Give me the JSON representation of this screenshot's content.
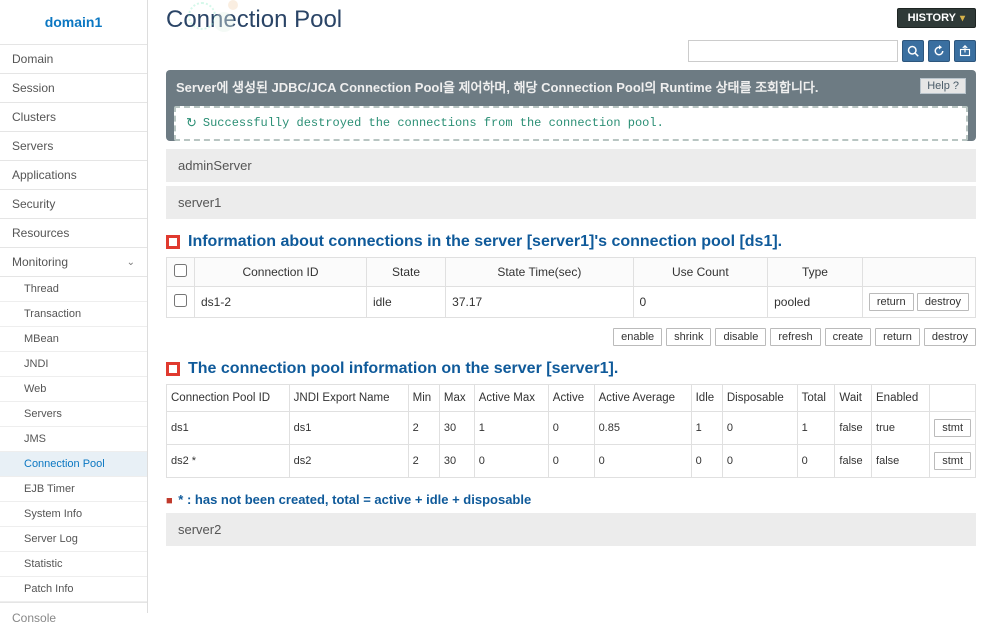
{
  "brand": "domain1",
  "nav": {
    "items": [
      "Domain",
      "Session",
      "Clusters",
      "Servers",
      "Applications",
      "Security",
      "Resources",
      "Monitoring"
    ],
    "expanded_label": "Monitoring",
    "sub": [
      "Thread",
      "Transaction",
      "MBean",
      "JNDI",
      "Web",
      "Servers",
      "JMS",
      "Connection Pool",
      "EJB Timer",
      "System Info",
      "Server Log",
      "Statistic",
      "Patch Info"
    ],
    "active_sub": "Connection Pool",
    "console": "Console"
  },
  "buttons": {
    "history": "HISTORY",
    "help": "Help ?",
    "enable": "enable",
    "shrink": "shrink",
    "disable": "disable",
    "refresh": "refresh",
    "create": "create",
    "return": "return",
    "destroy": "destroy",
    "stmt": "stmt"
  },
  "page": {
    "title": "Connection Pool"
  },
  "notice": {
    "text": "Server에 생성된 JDBC/JCA Connection Pool을 제어하며, 해당 Connection Pool의 Runtime 상태를 조회합니다.",
    "success": "Successfully destroyed the connections from the connection pool."
  },
  "servers": {
    "admin": "adminServer",
    "s1": "server1",
    "s2": "server2"
  },
  "section1": {
    "title": "Information about connections in the server [server1]'s connection pool [ds1].",
    "headers": [
      "Connection ID",
      "State",
      "State Time(sec)",
      "Use Count",
      "Type"
    ],
    "rows": [
      {
        "id": "ds1-2",
        "state": "idle",
        "time": "37.17",
        "use": "0",
        "type": "pooled"
      }
    ]
  },
  "section2": {
    "title": "The connection pool information on the server [server1].",
    "headers": [
      "Connection Pool ID",
      "JNDI Export Name",
      "Min",
      "Max",
      "Active Max",
      "Active",
      "Active Average",
      "Idle",
      "Disposable",
      "Total",
      "Wait",
      "Enabled"
    ],
    "rows": [
      {
        "id": "ds1",
        "jndi": "ds1",
        "min": "2",
        "max": "30",
        "amax": "1",
        "active": "0",
        "avg": "0.85",
        "idle": "1",
        "disp": "0",
        "total": "1",
        "wait": "false",
        "enabled": "true"
      },
      {
        "id": "ds2 *",
        "jndi": "ds2",
        "min": "2",
        "max": "30",
        "amax": "0",
        "active": "0",
        "avg": "0",
        "idle": "0",
        "disp": "0",
        "total": "0",
        "wait": "false",
        "enabled": "false"
      }
    ]
  },
  "legend": {
    "text": "* : has not been created, total = active + idle + disposable"
  },
  "search": {
    "placeholder": ""
  }
}
